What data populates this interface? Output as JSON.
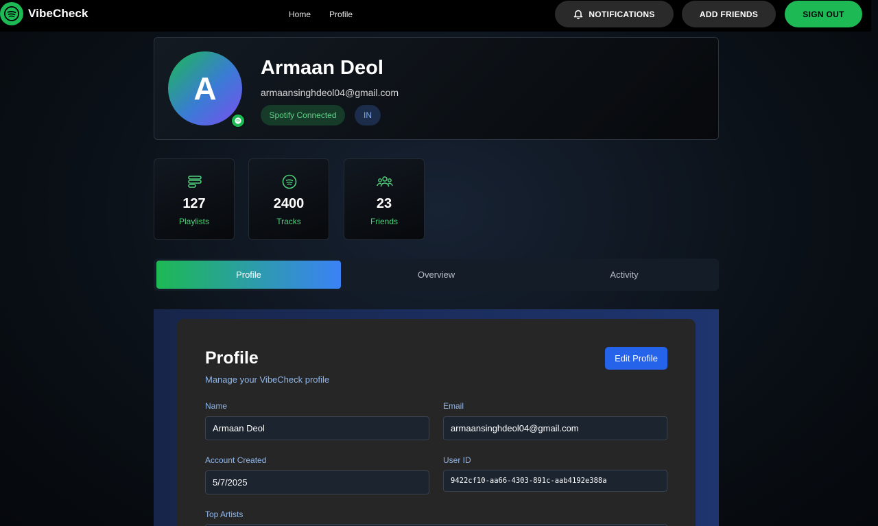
{
  "brand": {
    "name": "VibeCheck"
  },
  "nav": {
    "home": "Home",
    "profile": "Profile"
  },
  "actions": {
    "notifications": "NOTIFICATIONS",
    "add_friends": "ADD FRIENDS",
    "sign_out": "SIGN OUT"
  },
  "user": {
    "avatar_initial": "A",
    "name": "Armaan Deol",
    "email": "armaansinghdeol04@gmail.com",
    "spotify_badge": "Spotify Connected",
    "country": "IN"
  },
  "stats": [
    {
      "icon": "playlist-icon",
      "value": "127",
      "label": "Playlists"
    },
    {
      "icon": "spotify-icon",
      "value": "2400",
      "label": "Tracks"
    },
    {
      "icon": "friends-icon",
      "value": "23",
      "label": "Friends"
    }
  ],
  "tabs": [
    {
      "label": "Profile",
      "active": true
    },
    {
      "label": "Overview",
      "active": false
    },
    {
      "label": "Activity",
      "active": false
    }
  ],
  "profile_card": {
    "title": "Profile",
    "subtitle": "Manage your VibeCheck profile",
    "edit_button": "Edit Profile",
    "fields": {
      "name": {
        "label": "Name",
        "value": "Armaan Deol"
      },
      "email": {
        "label": "Email",
        "value": "armaansinghdeol04@gmail.com"
      },
      "account_created": {
        "label": "Account Created",
        "value": "5/7/2025"
      },
      "user_id": {
        "label": "User ID",
        "value": "9422cf10-aa66-4303-891c-aab4192e388a"
      },
      "top_artists": {
        "label": "Top Artists",
        "value": ""
      }
    }
  },
  "colors": {
    "accent_green": "#1db954",
    "accent_blue": "#2563eb",
    "label_blue": "#8fb6ea"
  }
}
